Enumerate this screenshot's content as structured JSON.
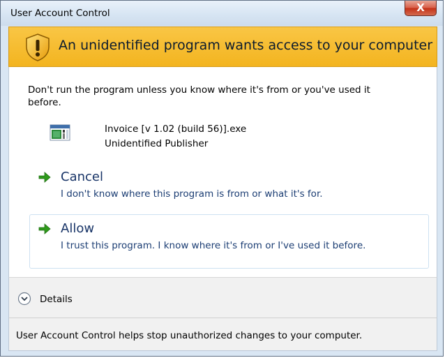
{
  "window": {
    "title": "User Account Control",
    "close_label": "X"
  },
  "banner": {
    "text": "An unidentified program wants access to your computer",
    "icon": "shield-warning-icon",
    "color": "#f5b82a"
  },
  "content": {
    "warning_line1": "Don't run the program unless you know where it's from or you've used it",
    "warning_line2": "before.",
    "program": {
      "icon": "program-icon",
      "name": "Invoice [v 1.02 (build 56)].exe",
      "publisher": "Unidentified Publisher"
    }
  },
  "options": [
    {
      "label": "Cancel",
      "description": "I don't know where this program is from or what it's for.",
      "icon": "green-arrow-icon"
    },
    {
      "label": "Allow",
      "description": "I trust this program. I know where it's from or I've used it before.",
      "icon": "green-arrow-icon"
    }
  ],
  "details": {
    "label": "Details",
    "icon": "chevron-down-circle-icon"
  },
  "footer": {
    "text": "User Account Control helps stop unauthorized changes to your computer."
  },
  "colors": {
    "accent_arrow": "#2f9a1c",
    "link_text": "#183467",
    "banner_bg": "#f5b82a"
  }
}
